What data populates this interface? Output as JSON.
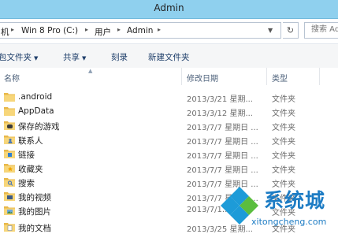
{
  "window": {
    "title": "Admin"
  },
  "address": {
    "crumbs": [
      "机",
      "Win 8 Pro (C:)",
      "用户",
      "Admin"
    ],
    "search_placeholder": "搜索 Admi"
  },
  "toolbar": {
    "organize_label": "包文件夹",
    "share_label": "共享",
    "burn_label": "刻录",
    "new_folder_label": "新建文件夹"
  },
  "columns": {
    "name": "名称",
    "date": "修改日期",
    "type": "类型"
  },
  "files": [
    {
      "name": ".android",
      "date": "2013/3/21 星期...",
      "type": "文件夹",
      "icon": "folder-icon"
    },
    {
      "name": "AppData",
      "date": "2013/3/12 星期...",
      "type": "文件夹",
      "icon": "folder-icon"
    },
    {
      "name": "保存的游戏",
      "date": "2013/7/7 星期日 ...",
      "type": "文件夹",
      "icon": "saved-games-icon"
    },
    {
      "name": "联系人",
      "date": "2013/7/7 星期日 ...",
      "type": "文件夹",
      "icon": "contacts-icon"
    },
    {
      "name": "链接",
      "date": "2013/7/7 星期日 ...",
      "type": "文件夹",
      "icon": "links-icon"
    },
    {
      "name": "收藏夹",
      "date": "2013/7/7 星期日 ...",
      "type": "文件夹",
      "icon": "favorites-icon"
    },
    {
      "name": "搜索",
      "date": "2013/7/7 星期日 ...",
      "type": "文件夹",
      "icon": "searches-icon"
    },
    {
      "name": "我的视频",
      "date": "2013/7/7 星期日 ...",
      "type": "文件夹",
      "icon": "videos-icon"
    },
    {
      "name": "我的图片",
      "date": "2013/7/1...",
      "type": "文件夹",
      "icon": "pictures-icon"
    },
    {
      "name": "我的文档",
      "date": "2013/3/25 星期...",
      "type": "文件夹",
      "icon": "documents-icon"
    }
  ],
  "watermark": {
    "brand": "系统城",
    "url": "xitongcheng.com"
  }
}
